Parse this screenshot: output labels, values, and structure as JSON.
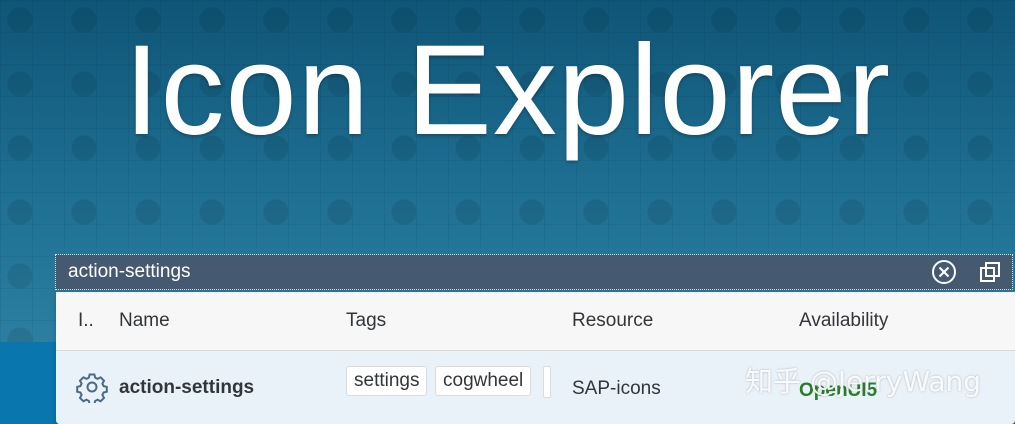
{
  "header": {
    "title": "Icon Explorer"
  },
  "search": {
    "value": "action-settings"
  },
  "table": {
    "columns": [
      "I..",
      "Name",
      "Tags",
      "Resource",
      "Availability"
    ],
    "rows": [
      {
        "icon": "gear-icon",
        "name": "action-settings",
        "tags": [
          "settings",
          "cogwheel"
        ],
        "resource": "SAP-icons",
        "availability": "OpenUI5"
      }
    ]
  },
  "watermark": "知乎 @JerryWang",
  "colors": {
    "header_bg": "#0f5577",
    "search_bg": "#455a70",
    "row_bg": "#e9f1f9",
    "availability": "#2b7d2b"
  }
}
